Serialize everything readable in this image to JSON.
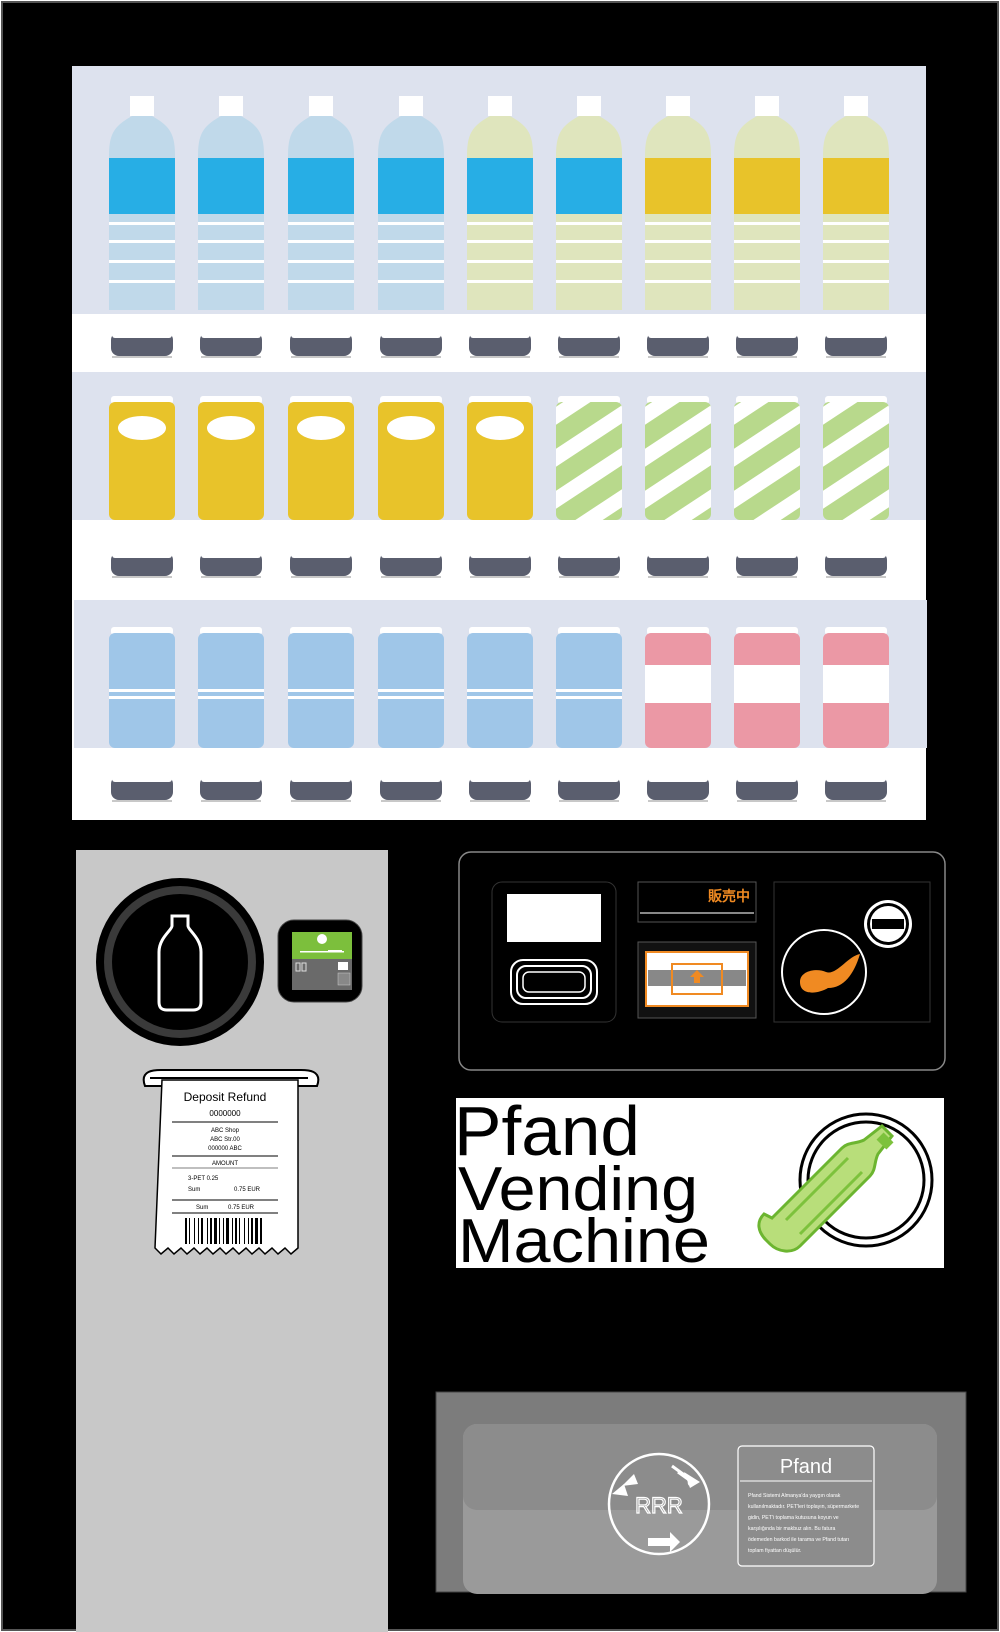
{
  "machine": {
    "status_sign": "販売中",
    "colors": {
      "body": "#000000",
      "display_bg": "#dde2ee",
      "shelf": "#ffffff",
      "water_blue": "#c0d9ea",
      "label_blue": "#27aee5",
      "tea_tint": "#dfe5bd",
      "label_yellow": "#e8c32a",
      "can_yellow": "#e8c32a",
      "can_green": "#b8d98c",
      "can_lightblue": "#9fc6e8",
      "can_pink": "#eb98a5",
      "return_panel": "#c8c8c8",
      "coin_orange": "#f08a22",
      "check_green": "#7cbf3c",
      "tray_grey": "#7c7c7c"
    },
    "shelves": [
      {
        "row": 1,
        "products": [
          "water-bottle",
          "water-bottle",
          "water-bottle",
          "water-bottle",
          "tea-bottle-blue-label",
          "tea-bottle-blue-label",
          "tea-bottle-yellow-label",
          "tea-bottle-yellow-label",
          "tea-bottle-yellow-label"
        ]
      },
      {
        "row": 2,
        "products": [
          "yellow-can",
          "yellow-can",
          "yellow-can",
          "yellow-can",
          "yellow-can",
          "green-striped-can",
          "green-striped-can",
          "green-striped-can",
          "green-striped-can"
        ]
      },
      {
        "row": 3,
        "products": [
          "blue-can",
          "blue-can",
          "blue-can",
          "blue-can",
          "blue-can",
          "blue-can",
          "pink-can",
          "pink-can",
          "pink-can"
        ]
      }
    ],
    "icons": {
      "bottle_return": "bottle-icon",
      "check": "check-icon",
      "coin_insert": "coin-slot-icon",
      "minus": "minus-icon",
      "recycle": "recycle-icon",
      "bottle_logo": "bottle-in-ring-icon"
    }
  },
  "receipt": {
    "title": "Deposit Refund",
    "number": "0000000",
    "shop_name": "ABC Shop",
    "shop_street": "ABC Str.00",
    "shop_zip": "000000 ABC",
    "amount_label": "AMOUNT",
    "item_line": "3-PET 0.25",
    "sum_label": "Sum",
    "sum_value": "0.75 EUR",
    "total_label": "Sum",
    "total_value": "0.75 EUR"
  },
  "banner": {
    "line1": "Pfand",
    "line2": "Vending",
    "line3": "Machine"
  },
  "info_card": {
    "title": "Pfand",
    "lines": [
      "Pfand Sistemi Almanya'da yaygın olarak",
      "kullanılmaktadır. PET'leri toplayın, süpermarkete",
      "gidin, PET'i toplama kutusuna koyun ve",
      "karşılığında bir makbuz alın. Bu fatura",
      "ödemeden barkod ile tarama ve Pfand tutarı",
      "toplam fiyattan düşülür."
    ]
  },
  "recycle_logo": {
    "text": "RRR"
  }
}
